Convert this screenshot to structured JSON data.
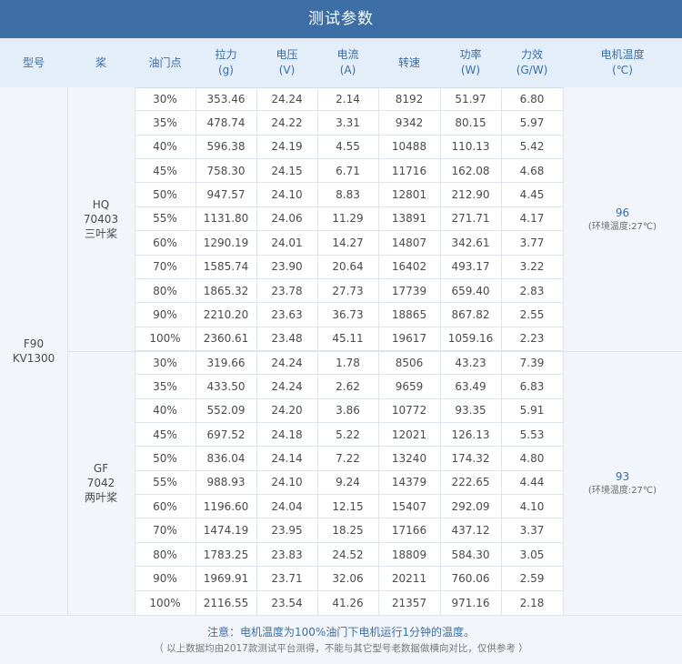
{
  "title": "测试参数",
  "headers": [
    {
      "lines": [
        "型号"
      ]
    },
    {
      "lines": [
        "桨"
      ]
    },
    {
      "lines": [
        "油门点"
      ]
    },
    {
      "lines": [
        "拉力",
        "(g)"
      ]
    },
    {
      "lines": [
        "电压",
        "(V)"
      ]
    },
    {
      "lines": [
        "电流",
        "(A)"
      ]
    },
    {
      "lines": [
        "转速"
      ]
    },
    {
      "lines": [
        "功率",
        "(W)"
      ]
    },
    {
      "lines": [
        "力效",
        "(G/W)"
      ]
    },
    {
      "lines": [
        "电机温度",
        "(℃)"
      ]
    }
  ],
  "model": {
    "lines": [
      "F90",
      "KV1300"
    ]
  },
  "groups": [
    {
      "prop": {
        "lines": [
          "HQ",
          "70403",
          "三叶桨"
        ]
      },
      "temp": {
        "value": "96",
        "note": "(环境温度:27℃)"
      },
      "rows": [
        [
          "30%",
          "353.46",
          "24.24",
          "2.14",
          "8192",
          "51.97",
          "6.80"
        ],
        [
          "35%",
          "478.74",
          "24.22",
          "3.31",
          "9342",
          "80.15",
          "5.97"
        ],
        [
          "40%",
          "596.38",
          "24.19",
          "4.55",
          "10488",
          "110.13",
          "5.42"
        ],
        [
          "45%",
          "758.30",
          "24.15",
          "6.71",
          "11716",
          "162.08",
          "4.68"
        ],
        [
          "50%",
          "947.57",
          "24.10",
          "8.83",
          "12801",
          "212.90",
          "4.45"
        ],
        [
          "55%",
          "1131.80",
          "24.06",
          "11.29",
          "13891",
          "271.71",
          "4.17"
        ],
        [
          "60%",
          "1290.19",
          "24.01",
          "14.27",
          "14807",
          "342.61",
          "3.77"
        ],
        [
          "70%",
          "1585.74",
          "23.90",
          "20.64",
          "16402",
          "493.17",
          "3.22"
        ],
        [
          "80%",
          "1865.32",
          "23.78",
          "27.73",
          "17739",
          "659.40",
          "2.83"
        ],
        [
          "90%",
          "2210.20",
          "23.63",
          "36.73",
          "18865",
          "867.82",
          "2.55"
        ],
        [
          "100%",
          "2360.61",
          "23.48",
          "45.11",
          "19617",
          "1059.16",
          "2.23"
        ]
      ]
    },
    {
      "prop": {
        "lines": [
          "GF",
          "7042",
          "两叶桨"
        ]
      },
      "temp": {
        "value": "93",
        "note": "(环境温度:27℃)"
      },
      "rows": [
        [
          "30%",
          "319.66",
          "24.24",
          "1.78",
          "8506",
          "43.23",
          "7.39"
        ],
        [
          "35%",
          "433.50",
          "24.24",
          "2.62",
          "9659",
          "63.49",
          "6.83"
        ],
        [
          "40%",
          "552.09",
          "24.20",
          "3.86",
          "10772",
          "93.35",
          "5.91"
        ],
        [
          "45%",
          "697.52",
          "24.18",
          "5.22",
          "12021",
          "126.13",
          "5.53"
        ],
        [
          "50%",
          "836.04",
          "24.14",
          "7.22",
          "13240",
          "174.32",
          "4.80"
        ],
        [
          "55%",
          "988.93",
          "24.10",
          "9.24",
          "14379",
          "222.65",
          "4.44"
        ],
        [
          "60%",
          "1196.60",
          "24.04",
          "12.15",
          "15407",
          "292.09",
          "4.10"
        ],
        [
          "70%",
          "1474.19",
          "23.95",
          "18.25",
          "17166",
          "437.12",
          "3.37"
        ],
        [
          "80%",
          "1783.25",
          "23.83",
          "24.52",
          "18809",
          "584.30",
          "3.05"
        ],
        [
          "90%",
          "1969.91",
          "23.71",
          "32.06",
          "20211",
          "760.06",
          "2.59"
        ],
        [
          "100%",
          "2116.55",
          "23.54",
          "41.26",
          "21357",
          "971.16",
          "2.18"
        ]
      ]
    }
  ],
  "footer": {
    "note": "注意：电机温度为100%油门下电机运行1分钟的温度。",
    "disclaimer": "（ 以上数据均由2017款测试平台测得，不能与其它型号老数据做横向对比，仅供参考 ）"
  }
}
